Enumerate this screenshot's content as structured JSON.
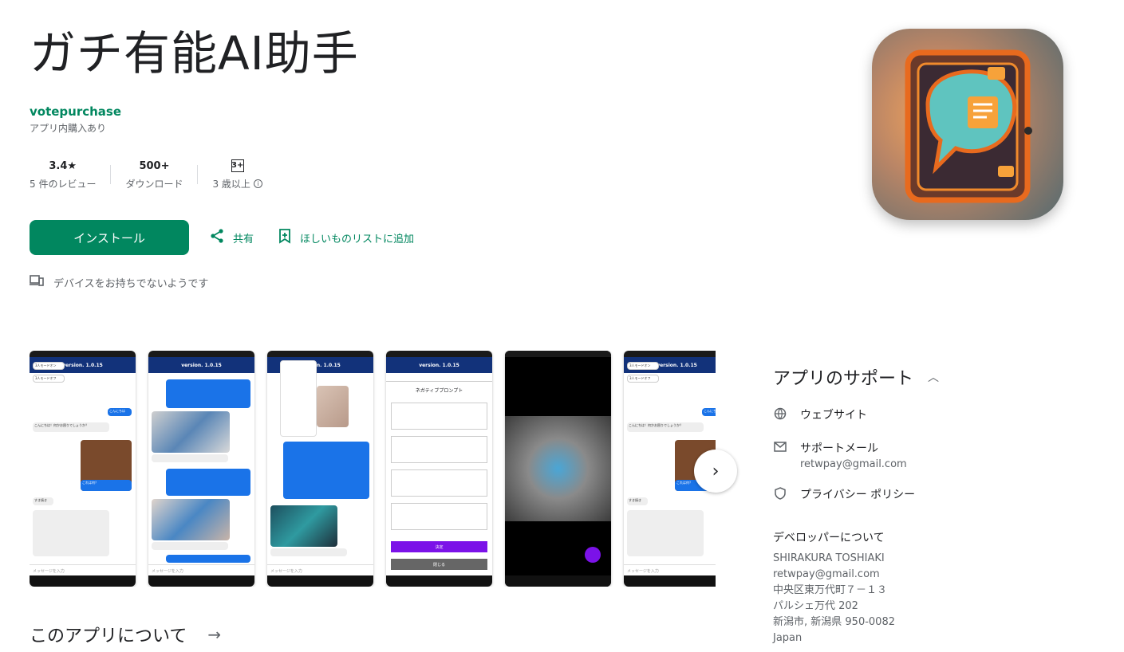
{
  "app": {
    "title": "ガチ有能AI助手",
    "developer": "votepurchase",
    "iap_note": "アプリ内購入あり"
  },
  "stats": {
    "rating_value": "3.4★",
    "rating_label": "5 件のレビュー",
    "downloads_value": "500+",
    "downloads_label": "ダウンロード",
    "age_value": "3+",
    "age_label": "3 歳以上"
  },
  "actions": {
    "install_label": "インストール",
    "share_label": "共有",
    "wishlist_label": "ほしいものリストに追加"
  },
  "device_note": "デバイスをお持ちでないようです",
  "screenshots": {
    "header_version": "version. 1.0.15",
    "input_placeholder": "メッセージを入力",
    "modal_title": "ネガティブプロンプト",
    "modal_submit": "決定",
    "modal_close": "閉じる",
    "dropdown_item1": "3人モードオン",
    "dropdown_item2": "3人モードオフ",
    "bubble_hello": "こんにちは",
    "bubble_hello_reply": "こんにちは！何かお困りでしょうか？",
    "bubble_what": "これは何？",
    "bubble_sukiyaki": "すき焼き"
  },
  "about": {
    "label": "このアプリについて"
  },
  "support": {
    "title": "アプリのサポート",
    "website": "ウェブサイト",
    "support_email_label": "サポートメール",
    "support_email": "retwpay@gmail.com",
    "privacy": "プライバシー ポリシー",
    "developer_about": "デベロッパーについて",
    "developer_lines": [
      "SHIRAKURA TOSHIAKI",
      "retwpay@gmail.com",
      "中央区東万代町７－１３",
      "パルシェ万代 202",
      "新潟市, 新潟県 950-0082",
      "Japan"
    ]
  },
  "colors": {
    "accent": "#01875f",
    "text": "#202124",
    "secondary": "#5f6368",
    "app_header": "#12327a"
  }
}
